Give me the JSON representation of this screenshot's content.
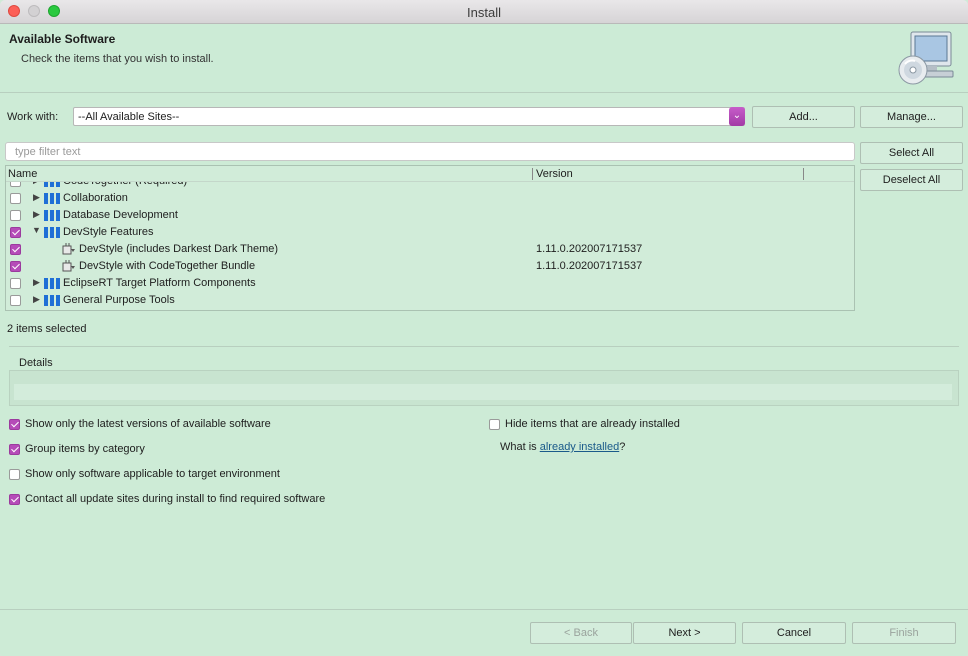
{
  "window": {
    "title": "Install"
  },
  "header": {
    "title": "Available Software",
    "description": "Check the items that you wish to install."
  },
  "work_with": {
    "label": "Work with:",
    "value": "--All Available Sites--",
    "add_label": "Add...",
    "manage_label": "Manage..."
  },
  "filter": {
    "placeholder": "type filter text"
  },
  "actions": {
    "select_all": "Select All",
    "deselect_all": "Deselect All"
  },
  "tree": {
    "columns": {
      "name": "Name",
      "version": "Version"
    },
    "rows": [
      {
        "label": "CodeTogether (Required)",
        "version": "",
        "checked": false,
        "type": "category",
        "expanded": false
      },
      {
        "label": "Collaboration",
        "version": "",
        "checked": false,
        "type": "category",
        "expanded": false
      },
      {
        "label": "Database Development",
        "version": "",
        "checked": false,
        "type": "category",
        "expanded": false
      },
      {
        "label": "DevStyle Features",
        "version": "",
        "checked": true,
        "type": "category",
        "expanded": true
      },
      {
        "label": "DevStyle (includes Darkest Dark Theme)",
        "version": "1.11.0.202007171537",
        "checked": true,
        "type": "feature"
      },
      {
        "label": "DevStyle with CodeTogether Bundle",
        "version": "1.11.0.202007171537",
        "checked": true,
        "type": "feature"
      },
      {
        "label": "EclipseRT Target Platform Components",
        "version": "",
        "checked": false,
        "type": "category",
        "expanded": false
      },
      {
        "label": "General Purpose Tools",
        "version": "",
        "checked": false,
        "type": "category",
        "expanded": false
      }
    ]
  },
  "selection_status": "2 items selected",
  "details": {
    "label": "Details"
  },
  "options": {
    "latest_versions": {
      "label": "Show only the latest versions of available software",
      "checked": true
    },
    "group_by_category": {
      "label": "Group items by category",
      "checked": true
    },
    "target_env": {
      "label": "Show only software applicable to target environment",
      "checked": false
    },
    "contact_sites": {
      "label": "Contact all update sites during install to find required software",
      "checked": true
    },
    "hide_installed": {
      "label": "Hide items that are already installed",
      "checked": false
    },
    "installed_prefix": "What is ",
    "installed_link": "already installed",
    "installed_suffix": "?"
  },
  "footer": {
    "back": "< Back",
    "next": "Next >",
    "cancel": "Cancel",
    "finish": "Finish"
  },
  "colors": {
    "accent": "#b54bb8",
    "background": "#cdebd6",
    "category_icon": "#1f6fd6"
  }
}
